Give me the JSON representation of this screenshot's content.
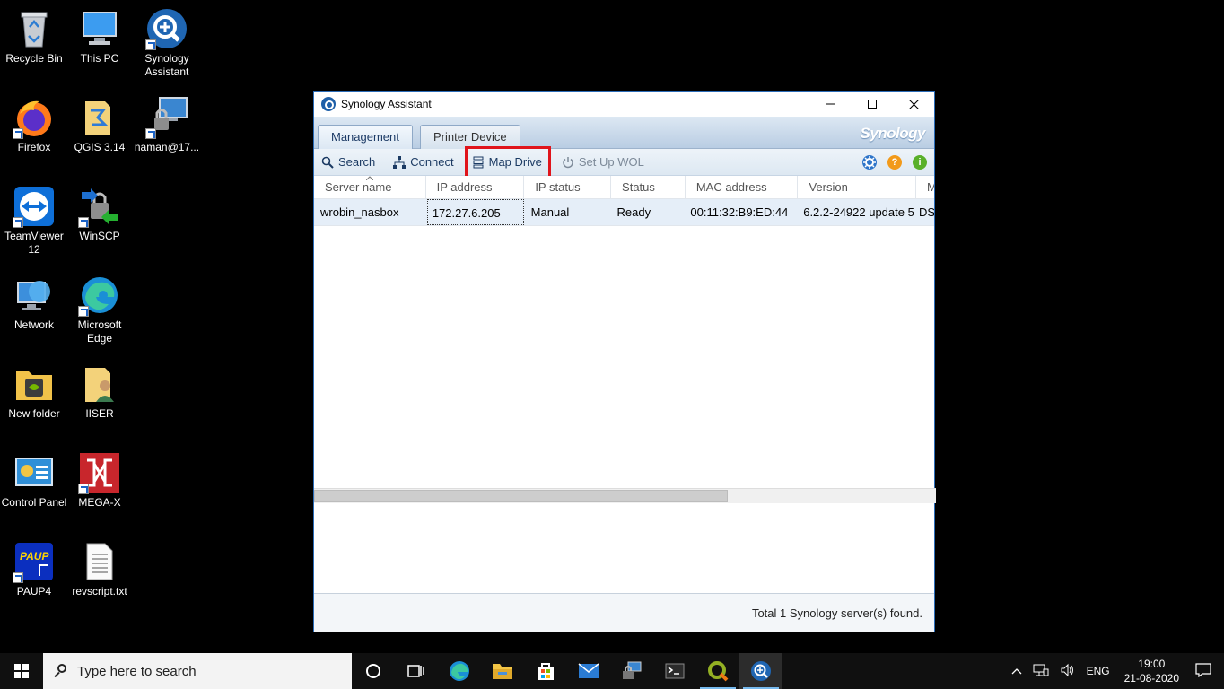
{
  "desktop": {
    "icons": [
      {
        "label": "Recycle Bin"
      },
      {
        "label": "This PC"
      },
      {
        "label": "Synology Assistant"
      },
      {
        "label": "Firefox"
      },
      {
        "label": "QGIS 3.14"
      },
      {
        "label": "naman@17..."
      },
      {
        "label": "TeamViewer 12"
      },
      {
        "label": "WinSCP"
      },
      {
        "label": "Network"
      },
      {
        "label": "Microsoft Edge"
      },
      {
        "label": "New folder"
      },
      {
        "label": "IISER"
      },
      {
        "label": "Control Panel"
      },
      {
        "label": "MEGA-X"
      },
      {
        "label": "PAUP4"
      },
      {
        "label": "revscript.txt"
      }
    ]
  },
  "window": {
    "title": "Synology Assistant",
    "tabs": [
      {
        "label": "Management",
        "active": true
      },
      {
        "label": "Printer Device",
        "active": false
      }
    ],
    "brand": "Synology",
    "toolbar": {
      "search": "Search",
      "connect": "Connect",
      "map_drive": "Map Drive",
      "setup_wol": "Set Up WOL"
    },
    "grid": {
      "columns": [
        "Server name",
        "IP address",
        "IP status",
        "Status",
        "MAC address",
        "Version",
        "M"
      ],
      "rows": [
        {
          "server_name": "wrobin_nasbox",
          "ip_address": "172.27.6.205",
          "ip_status": "Manual",
          "status": "Ready",
          "mac_address": "00:11:32:B9:ED:44",
          "version": "6.2.2-24922 update 5",
          "model": "DS"
        }
      ]
    },
    "status_text": "Total 1 Synology server(s) found."
  },
  "taskbar": {
    "search_placeholder": "Type here to search",
    "language": "ENG",
    "time": "19:00",
    "date": "21-08-2020"
  },
  "colors": {
    "highlight_box": "#e0141b",
    "row_selected": "#e5eef8",
    "window_border": "#2b6cb8"
  }
}
